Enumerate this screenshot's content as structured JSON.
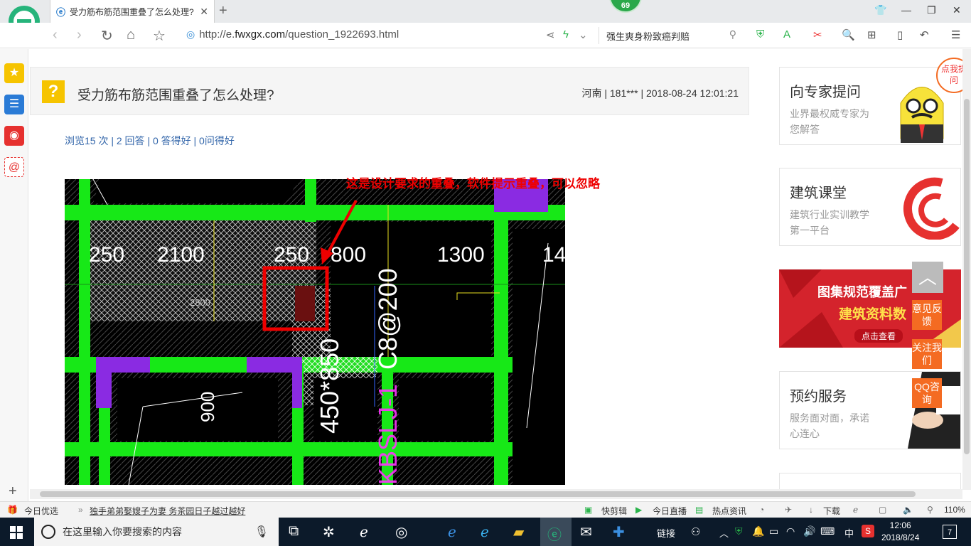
{
  "browser": {
    "tab_title": "受力筋布筋范围重叠了怎么处理?",
    "badge_count": "69",
    "url_prefix": "http://e.",
    "url_domain": "fwxgx.com",
    "url_path": "/question_1922693.html",
    "search_text": "强生爽身粉致癌判赔"
  },
  "question": {
    "title": "受力筋布筋范围重叠了怎么处理?",
    "meta": "河南 | 181*** | 2018-08-24 12:01:21",
    "stats": "浏览15 次 | 2 回答 | 0 答得好 | 0问得好"
  },
  "image": {
    "annotation": "这是设计要求的重叠，软件提示重叠，可以忽略",
    "dims": [
      "250",
      "2100",
      "250",
      "800",
      "1300",
      "14",
      "900",
      "2800"
    ],
    "vertical_label_1": "450*850",
    "vertical_label_2": "C8@200",
    "vertical_label_3": "KBSLJ-1"
  },
  "right": {
    "cards": [
      {
        "title": "向专家提问",
        "sub": "业界最权威专家为您解答"
      },
      {
        "title": "建筑课堂",
        "sub": "建筑行业实训教学第一平台"
      },
      {
        "title": "预约服务",
        "sub": "服务面对面，承诺心连心"
      }
    ],
    "banner_line1": "图集规范覆盖广",
    "banner_line2": "建筑资料数",
    "banner_btn": "点击查看",
    "corner_tag": "点我提问",
    "float_buttons": [
      "意见反馈",
      "关注我们",
      "QQ咨询"
    ]
  },
  "statusbar": {
    "left": "今日优选",
    "news": "独手弟弟娶嫂子为妻 务茶园日子越过越好",
    "items": [
      "快剪辑",
      "今日直播",
      "热点资讯",
      "下载"
    ],
    "zoom": "110%"
  },
  "taskbar": {
    "search_placeholder": "在这里输入你要搜索的内容",
    "link_label": "链接",
    "ime": "中",
    "time": "12:06",
    "date": "2018/8/24",
    "notif_count": "7"
  }
}
